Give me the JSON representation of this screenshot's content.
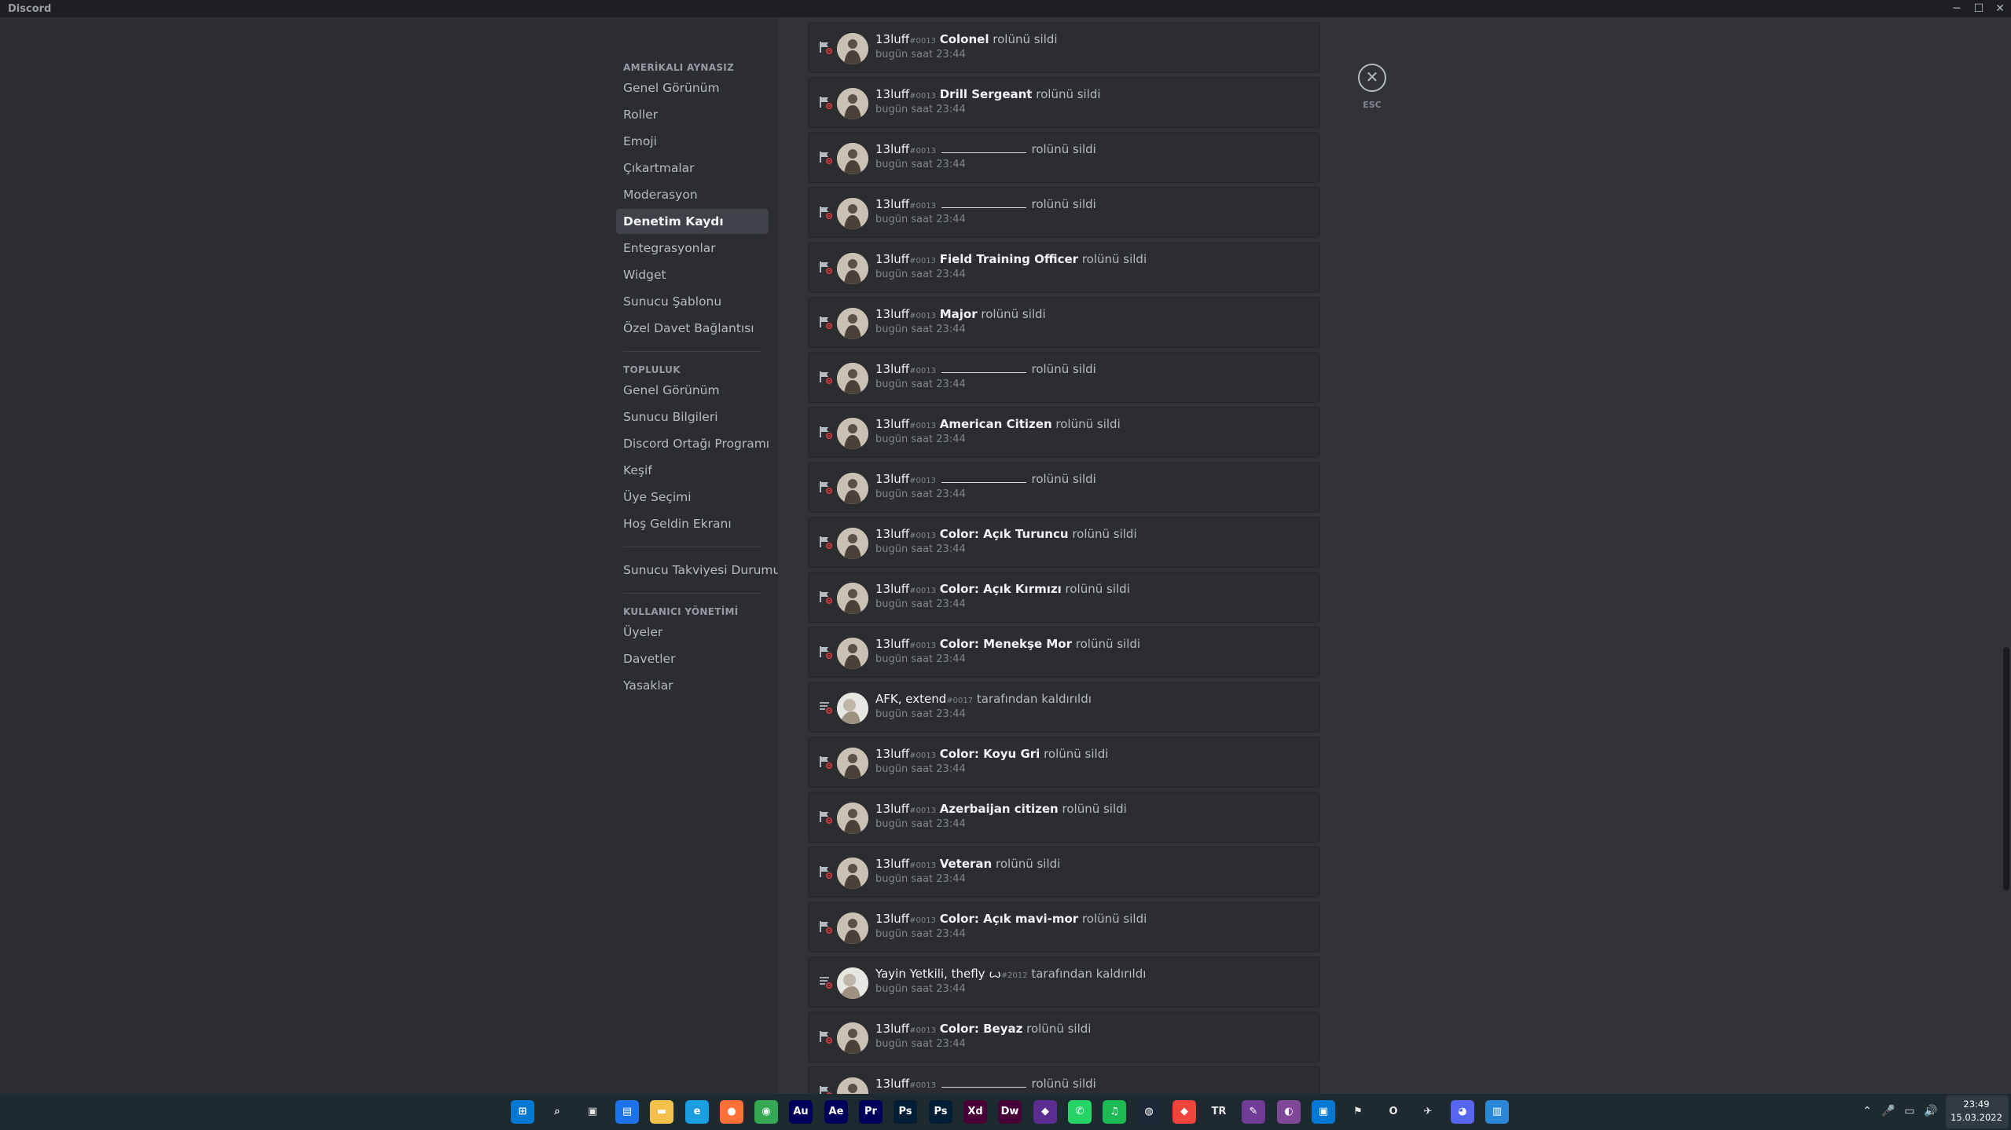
{
  "window": {
    "title": "Discord",
    "controls": {
      "minimize": "─",
      "maximize": "☐",
      "close": "✕"
    }
  },
  "sidebar": {
    "sections": [
      {
        "header": "AMERİKALI AYNASIZ",
        "items": [
          "Genel Görünüm",
          "Roller",
          "Emoji",
          "Çıkartmalar",
          "Moderasyon",
          "Denetim Kaydı",
          "Entegrasyonlar",
          "Widget",
          "Sunucu Şablonu",
          "Özel Davet Bağlantısı"
        ],
        "selected_index": 5
      },
      {
        "header": "TOPLULUK",
        "items": [
          "Genel Görünüm",
          "Sunucu Bilgileri",
          "Discord Ortağı Programı",
          "Keşif",
          "Üye Seçimi",
          "Hoş Geldin Ekranı"
        ]
      },
      {
        "header": "",
        "items": [
          "Sunucu Takviyesi Durumu"
        ]
      },
      {
        "header": "KULLANICI YÖNETİMİ",
        "items": [
          "Üyeler",
          "Davetler",
          "Yasaklar"
        ]
      }
    ]
  },
  "close": {
    "icon": "✕",
    "hint": "ESC"
  },
  "audit_log": {
    "entries": [
      {
        "icon": "role-delete-icon",
        "user": "13luff",
        "disc": "#0013",
        "target": "Colonel",
        "action": "rolünü sildi",
        "time": "bugün saat 23:44"
      },
      {
        "icon": "role-delete-icon",
        "user": "13luff",
        "disc": "#0013",
        "target": "Drill Sergeant",
        "action": "rolünü sildi",
        "time": "bugün saat 23:44"
      },
      {
        "icon": "role-delete-icon",
        "user": "13luff",
        "disc": "#0013",
        "target": "",
        "action": "rolünü sildi",
        "time": "bugün saat 23:44"
      },
      {
        "icon": "role-delete-icon",
        "user": "13luff",
        "disc": "#0013",
        "target": "",
        "action": "rolünü sildi",
        "time": "bugün saat 23:44"
      },
      {
        "icon": "role-delete-icon",
        "user": "13luff",
        "disc": "#0013",
        "target": "Field Training Officer",
        "action": "rolünü sildi",
        "time": "bugün saat 23:44"
      },
      {
        "icon": "role-delete-icon",
        "user": "13luff",
        "disc": "#0013",
        "target": "Major",
        "action": "rolünü sildi",
        "time": "bugün saat 23:44"
      },
      {
        "icon": "role-delete-icon",
        "user": "13luff",
        "disc": "#0013",
        "target": "",
        "action": "rolünü sildi",
        "time": "bugün saat 23:44"
      },
      {
        "icon": "role-delete-icon",
        "user": "13luff",
        "disc": "#0013",
        "target": "American Citizen",
        "action": "rolünü sildi",
        "time": "bugün saat 23:44"
      },
      {
        "icon": "role-delete-icon",
        "user": "13luff",
        "disc": "#0013",
        "target": "",
        "action": "rolünü sildi",
        "time": "bugün saat 23:44"
      },
      {
        "icon": "role-delete-icon",
        "user": "13luff",
        "disc": "#0013",
        "target": "Color: Açık Turuncu",
        "action": "rolünü sildi",
        "time": "bugün saat 23:44"
      },
      {
        "icon": "role-delete-icon",
        "user": "13luff",
        "disc": "#0013",
        "target": "Color: Açık Kırmızı",
        "action": "rolünü sildi",
        "time": "bugün saat 23:44"
      },
      {
        "icon": "role-delete-icon",
        "user": "13luff",
        "disc": "#0013",
        "target": "Color: Menekşe Mor",
        "action": "rolünü sildi",
        "time": "bugün saat 23:44"
      },
      {
        "icon": "member-role-remove-icon",
        "user": "AFK",
        "user_suffix": ", extend",
        "disc": "#0017",
        "target": "",
        "action": "tarafından kaldırıldı",
        "time": "bugün saat 23:44"
      },
      {
        "icon": "role-delete-icon",
        "user": "13luff",
        "disc": "#0013",
        "target": "Color: Koyu Gri",
        "action": "rolünü sildi",
        "time": "bugün saat 23:44"
      },
      {
        "icon": "role-delete-icon",
        "user": "13luff",
        "disc": "#0013",
        "target": "Azerbaijan citizen",
        "action": "rolünü sildi",
        "time": "bugün saat 23:44"
      },
      {
        "icon": "role-delete-icon",
        "user": "13luff",
        "disc": "#0013",
        "target": "Veteran",
        "action": "rolünü sildi",
        "time": "bugün saat 23:44"
      },
      {
        "icon": "role-delete-icon",
        "user": "13luff",
        "disc": "#0013",
        "target": "Color: Açık mavi-mor",
        "action": "rolünü sildi",
        "time": "bugün saat 23:44"
      },
      {
        "icon": "member-role-remove-icon",
        "user": "Yayin Yetkili",
        "user_suffix": ", thefly ꙍ",
        "disc": "#2012",
        "target": "",
        "action": "tarafından kaldırıldı",
        "time": "bugün saat 23:44"
      },
      {
        "icon": "role-delete-icon",
        "user": "13luff",
        "disc": "#0013",
        "target": "Color: Beyaz",
        "action": "rolünü sildi",
        "time": "bugün saat 23:44"
      },
      {
        "icon": "role-delete-icon",
        "user": "13luff",
        "disc": "#0013",
        "target": "",
        "action": "rolünü sildi",
        "time": ""
      }
    ]
  },
  "taskbar": {
    "apps": [
      {
        "name": "start-button",
        "label": "⊞",
        "color": "#0078d4"
      },
      {
        "name": "search-icon",
        "label": "⌕",
        "color": "transparent"
      },
      {
        "name": "task-view-icon",
        "label": "▣",
        "color": "transparent"
      },
      {
        "name": "widgets-icon",
        "label": "▤",
        "color": "#1a73e8"
      },
      {
        "name": "file-explorer-icon",
        "label": "▬",
        "color": "#f2c04b"
      },
      {
        "name": "edge-icon",
        "label": "e",
        "color": "#1b9de2"
      },
      {
        "name": "firefox-icon",
        "label": "●",
        "color": "#ff7139"
      },
      {
        "name": "chrome-icon",
        "label": "◉",
        "color": "#34a853"
      },
      {
        "name": "audition-icon",
        "label": "Au",
        "color": "#00005b"
      },
      {
        "name": "after-effects-icon",
        "label": "Ae",
        "color": "#00005b"
      },
      {
        "name": "premiere-icon",
        "label": "Pr",
        "color": "#00005b"
      },
      {
        "name": "photoshop-icon",
        "label": "Ps",
        "color": "#001e36"
      },
      {
        "name": "photoshop-alt-icon",
        "label": "Ps",
        "color": "#001e36"
      },
      {
        "name": "xd-icon",
        "label": "Xd",
        "color": "#470137"
      },
      {
        "name": "dreamweaver-icon",
        "label": "Dw",
        "color": "#470137"
      },
      {
        "name": "visual-studio-icon",
        "label": "◆",
        "color": "#5c2d91"
      },
      {
        "name": "whatsapp-icon",
        "label": "✆",
        "color": "#25d366"
      },
      {
        "name": "spotify-icon",
        "label": "♫",
        "color": "#1db954"
      },
      {
        "name": "steam-icon",
        "label": "◍",
        "color": "#1b2838"
      },
      {
        "name": "anydesk-icon",
        "label": "◆",
        "color": "#ef443b"
      },
      {
        "name": "tr-icon",
        "label": "TR",
        "color": "transparent"
      },
      {
        "name": "lightshot-icon",
        "label": "✎",
        "color": "#6f3c96"
      },
      {
        "name": "tor-icon",
        "label": "◐",
        "color": "#7e4798"
      },
      {
        "name": "window-app-icon",
        "label": "▣",
        "color": "#0078d4"
      },
      {
        "name": "network-app-icon",
        "label": "⚑",
        "color": "transparent"
      },
      {
        "name": "opera-icon",
        "label": "O",
        "color": "transparent"
      },
      {
        "name": "plane-app-icon",
        "label": "✈",
        "color": "transparent"
      },
      {
        "name": "discord-icon",
        "label": "◕",
        "color": "#5865f2"
      },
      {
        "name": "notepad-icon",
        "label": "▥",
        "color": "#2b88d8"
      }
    ],
    "tray": [
      "⌃",
      "🎤",
      "▭",
      "🔊"
    ],
    "clock": {
      "time": "23:49",
      "date": "15.03.2022"
    }
  }
}
